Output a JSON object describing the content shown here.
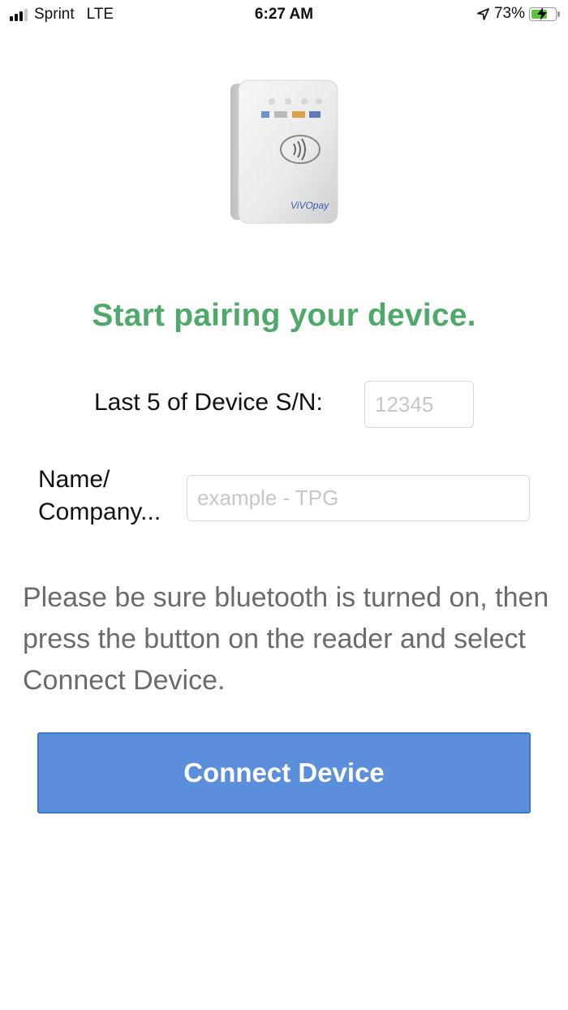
{
  "status_bar": {
    "carrier": "Sprint",
    "network": "LTE",
    "time": "6:27 AM",
    "battery_percent": "73%",
    "battery_level": 0.73,
    "signal_bars": 3,
    "signal_bars_max": 4
  },
  "device_image": {
    "brand_text": "ViVOpay"
  },
  "title": "Start pairing your device.",
  "form": {
    "serial_label": "Last 5 of Device S/N:",
    "serial_placeholder": "12345",
    "name_label_line1": "Name/",
    "name_label_line2": "Company...",
    "name_placeholder": "example - TPG"
  },
  "instructions": "Please be sure bluetooth is turned on, then press the button on the reader and select Connect Device.",
  "connect_button_label": "Connect Device",
  "colors": {
    "title": "#4fa96a",
    "button": "#5b8fdc",
    "instructions": "#6b6b6b",
    "battery": "#5cc43d"
  }
}
